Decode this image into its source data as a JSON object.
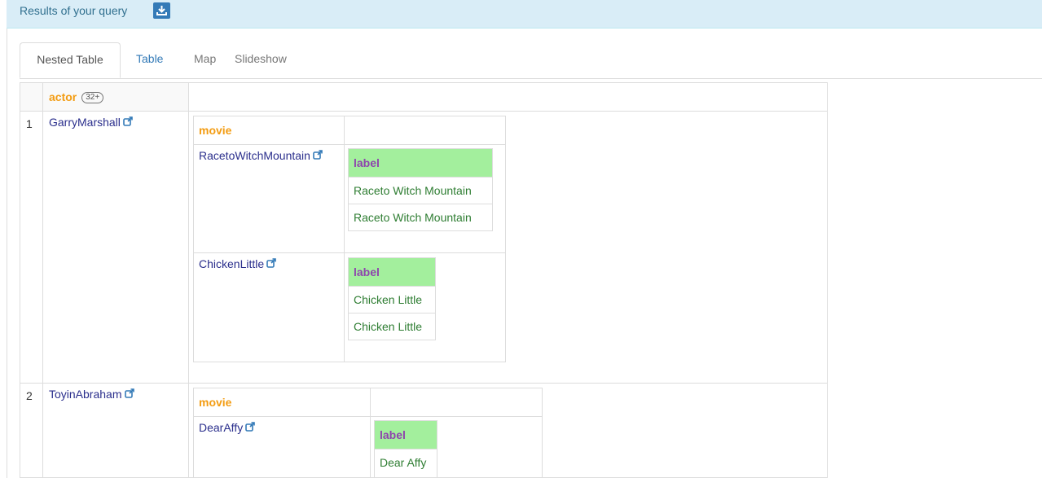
{
  "panel": {
    "title": "Results of your query",
    "download_icon": "download-icon"
  },
  "tabs": [
    {
      "label": "Nested Table",
      "active": true
    },
    {
      "label": "Table",
      "active": false
    },
    {
      "label": "Map",
      "active": false
    },
    {
      "label": "Slideshow",
      "active": false
    }
  ],
  "table": {
    "header": {
      "label": "actor",
      "count": "32+"
    },
    "rows": [
      {
        "num": "1",
        "actor": "GarryMarshall",
        "movie_header": "movie",
        "movies": [
          {
            "name": "RacetoWitchMountain",
            "label_header": "label",
            "labels": [
              "Raceto Witch Mountain",
              "Raceto Witch Mountain"
            ]
          },
          {
            "name": "ChickenLittle",
            "label_header": "label",
            "labels": [
              "Chicken Little",
              "Chicken Little"
            ]
          }
        ]
      },
      {
        "num": "2",
        "actor": "ToyinAbraham",
        "movie_header": "movie",
        "movies": [
          {
            "name": "DearAffy",
            "label_header": "label",
            "labels": [
              "Dear Affy"
            ]
          }
        ]
      }
    ]
  },
  "colors": {
    "orange": "#f39c12",
    "purple": "#8e44ad",
    "green_bg": "#a3ef9d",
    "green_text": "#2e7d32",
    "link": "#2a2e8c"
  }
}
